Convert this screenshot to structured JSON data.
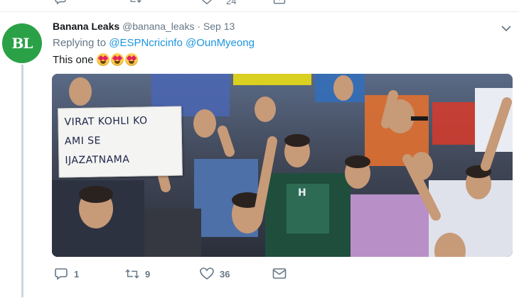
{
  "previous_tweet": {
    "like_count": "24"
  },
  "tweet": {
    "avatar_initials": "BL",
    "author_name": "Banana Leaks",
    "author_handle": "@banana_leaks",
    "separator": "·",
    "date": "Sep 13",
    "replying_prefix": "Replying to",
    "replying_to": [
      "@ESPNcricinfo",
      "@OunMyeong"
    ],
    "text": "This one",
    "emojis": [
      "heart-eyes-emoji",
      "heart-eyes-emoji",
      "heart-eyes-emoji"
    ],
    "media": {
      "sign_text": [
        "VIRAT KOHLI KO",
        "AMI SE",
        "IJAZATNAMA"
      ],
      "jersey_text": "H"
    },
    "actions": {
      "reply_count": "1",
      "retweet_count": "9",
      "like_count": "36"
    }
  },
  "colors": {
    "avatar_bg": "#2aa147",
    "link": "#1b95e0",
    "muted": "#657786",
    "divider": "#e6ecf0",
    "thread_line": "#ccd6dd"
  },
  "icons": [
    "reply-icon",
    "retweet-icon",
    "like-icon",
    "message-icon",
    "chevron-down-icon"
  ]
}
